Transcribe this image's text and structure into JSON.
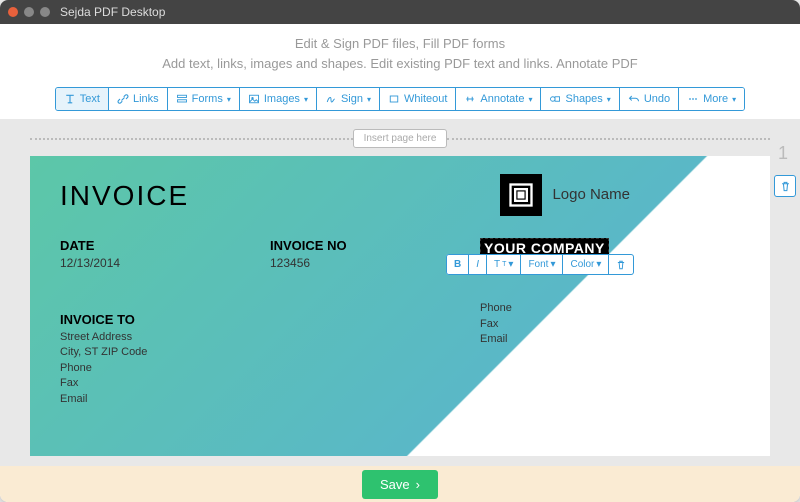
{
  "window": {
    "title": "Sejda PDF Desktop"
  },
  "header": {
    "line1": "Edit & Sign PDF files, Fill PDF forms",
    "line2": "Add text, links, images and shapes. Edit existing PDF text and links. Annotate PDF"
  },
  "toolbar": {
    "text": "Text",
    "links": "Links",
    "forms": "Forms",
    "images": "Images",
    "sign": "Sign",
    "whiteout": "Whiteout",
    "annotate": "Annotate",
    "shapes": "Shapes",
    "undo": "Undo",
    "more": "More"
  },
  "insert": {
    "label": "Insert page here"
  },
  "page": {
    "number": "1"
  },
  "doc": {
    "title": "INVOICE",
    "date_label": "DATE",
    "date_value": "12/13/2014",
    "invoiceno_label": "INVOICE NO",
    "invoiceno_value": "123456",
    "company_label": "YOUR COMPANY",
    "street": "Street Address",
    "citystate": "City, ST ZIP Code",
    "phone": "Phone",
    "fax": "Fax",
    "email": "Email",
    "logo_name": "Logo Name",
    "invoice_to": "INVOICE TO"
  },
  "fmt": {
    "bold": "B",
    "italic": "I",
    "size": "T",
    "font": "Font",
    "color": "Color"
  },
  "footer": {
    "save": "Save"
  }
}
